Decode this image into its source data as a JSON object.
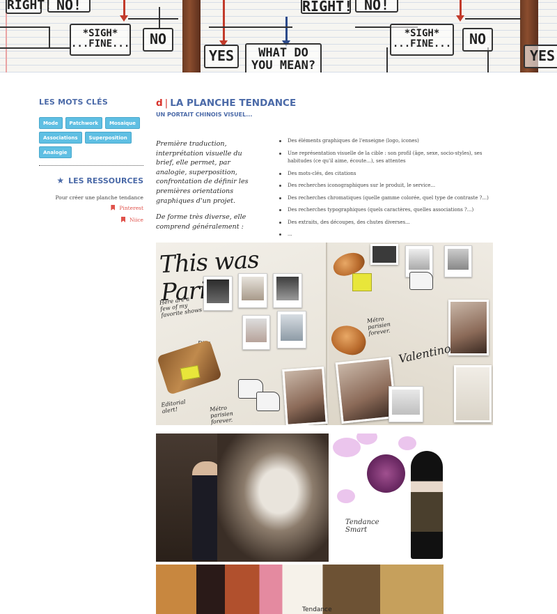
{
  "banner": {
    "boxes": [
      "RIGHT!",
      "NO!",
      "*SIGH*\n...FINE...",
      "NO",
      "YES",
      "WHAT DO\nYOU MEAN?",
      "RIGHT!",
      "NO!",
      "*SIGH*\n...FINE...",
      "NO",
      "YES"
    ]
  },
  "sidebar": {
    "keywords_heading": "LES MOTS CLÉS",
    "tags": [
      "Mode",
      "Patchwork",
      "Mosaique",
      "Associations",
      "Superposition",
      "Analogie"
    ],
    "resources_heading": "LES RESSOURCES",
    "resources_text": "Pour créer une planche tendance",
    "links": [
      "Pinterest",
      "Niice"
    ]
  },
  "main": {
    "letter": "d",
    "separator": "|",
    "title": "LA PLANCHE TENDANCE",
    "subtitle": "UN PORTAIT CHINOIS VISUEL...",
    "intro_p1": "Première traduction, interprétation visuelle du brief, elle permet, par analogie, superposition, confrontation de définir les premières orientations graphiques d'un projet.",
    "intro_p2": "De forme très diverse, elle comprend généralement :",
    "bullets": [
      "Des éléments graphiques de l'enseigne (logo, icones)",
      "Une représentation visuelle de la cible : son profil (âge, sexe, socio-styles), ses habitudes (ce qu'il aime, écoute...), ses attentes",
      "Des mots-clés, des citations",
      "Des recherches iconographiques sur le produit, le service...",
      "Des recherches chromatiques (quelle gamme colorée, quel type de contraste ?...)",
      "Des recherches typographiques (quels caractères, quelles associations ?...)",
      "Des extraits, des découpes, des chutes diverses...",
      "..."
    ]
  },
  "images": {
    "moodboard1_title": "This was Paris!",
    "moodboard1_notes": [
      "Here are a few of my favorite shows",
      "Editorial alert!",
      "Métro parisien forever.",
      "Valentino",
      "Dior"
    ],
    "moodboard2_label": "Tendance Smart",
    "moodboard3_label": "Tendance"
  },
  "colors": {
    "accent_blue": "#4b6aa8",
    "accent_red": "#d8332c",
    "tag_blue": "#5fbfe3",
    "link_red": "#e0524b"
  }
}
